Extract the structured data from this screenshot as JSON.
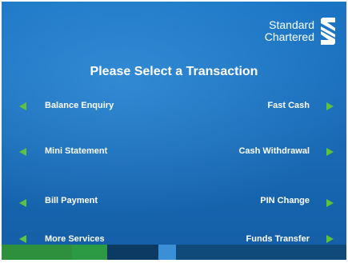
{
  "brand": {
    "line1": "Standard",
    "line2": "Chartered",
    "logo_icon": "standard-chartered-logo"
  },
  "title": "Please Select a Transaction",
  "options": {
    "left": [
      {
        "label": "Balance Enquiry",
        "icon": "arrow-left-icon"
      },
      {
        "label": "Mini Statement",
        "icon": "arrow-left-icon"
      },
      {
        "label": "Bill Payment",
        "icon": "arrow-left-icon"
      },
      {
        "label": "More Services",
        "icon": "arrow-left-icon"
      }
    ],
    "right": [
      {
        "label": "Fast Cash",
        "icon": "arrow-right-icon"
      },
      {
        "label": "Cash Withdrawal",
        "icon": "arrow-right-icon"
      },
      {
        "label": "PIN Change",
        "icon": "arrow-right-icon"
      },
      {
        "label": "Funds Transfer",
        "icon": "arrow-right-icon"
      }
    ]
  },
  "colors": {
    "background": "#1a6db9",
    "arrow": "#5fc23e",
    "strip": [
      "#2e8f3c",
      "#2c9a44",
      "#0d3a63",
      "#3a8fd6",
      "#0f4a7a"
    ]
  }
}
